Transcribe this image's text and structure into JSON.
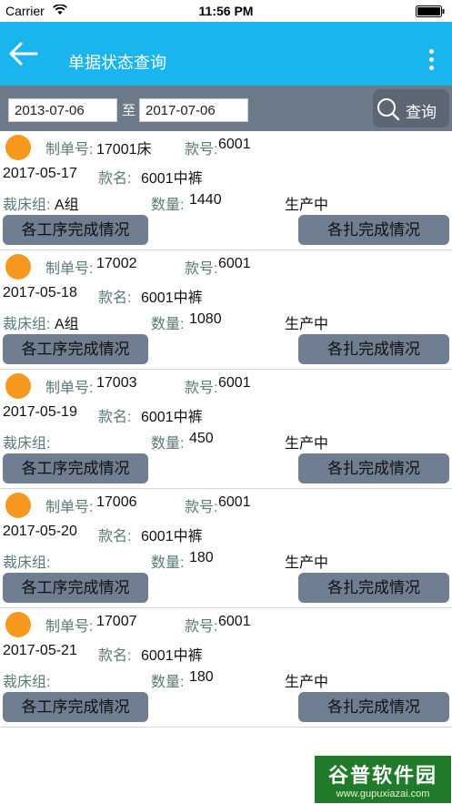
{
  "status_bar": {
    "carrier": "Carrier",
    "time": "11:56 PM"
  },
  "nav": {
    "title": "单据状态查询"
  },
  "search": {
    "from_date": "2013-07-06",
    "to_label": "至",
    "to_date": "2017-07-06",
    "button_label": "查询"
  },
  "labels": {
    "order_no": "制单号:",
    "style_no": "款号:",
    "style_name": "款名:",
    "cutting_group": "裁床组:",
    "quantity": "数量:",
    "process_btn": "各工序完成情况",
    "bundle_btn": "各扎完成情况"
  },
  "orders": [
    {
      "order_no": "17001床",
      "style_no": "6001",
      "date": "2017-05-17",
      "style_name": "6001中裤",
      "group": "A组",
      "quantity": "1440",
      "status": "生产中"
    },
    {
      "order_no": "17002",
      "style_no": "6001",
      "date": "2017-05-18",
      "style_name": "6001中裤",
      "group": "A组",
      "quantity": "1080",
      "status": "生产中"
    },
    {
      "order_no": "17003",
      "style_no": "6001",
      "date": "2017-05-19",
      "style_name": "6001中裤",
      "group": "",
      "quantity": "450",
      "status": "生产中"
    },
    {
      "order_no": "17006",
      "style_no": "6001",
      "date": "2017-05-20",
      "style_name": "6001中裤",
      "group": "",
      "quantity": "180",
      "status": "生产中"
    },
    {
      "order_no": "17007",
      "style_no": "6001",
      "date": "2017-05-21",
      "style_name": "6001中裤",
      "group": "",
      "quantity": "180",
      "status": "生产中"
    }
  ],
  "watermark": {
    "title": "谷普软件园",
    "url": "www.gupuxiazai.com"
  },
  "colors": {
    "nav": "#1ab4ee",
    "search_bar": "#6d7a8a",
    "dot": "#f7981e",
    "button": "#6f7e91",
    "label": "#5b7a76"
  }
}
